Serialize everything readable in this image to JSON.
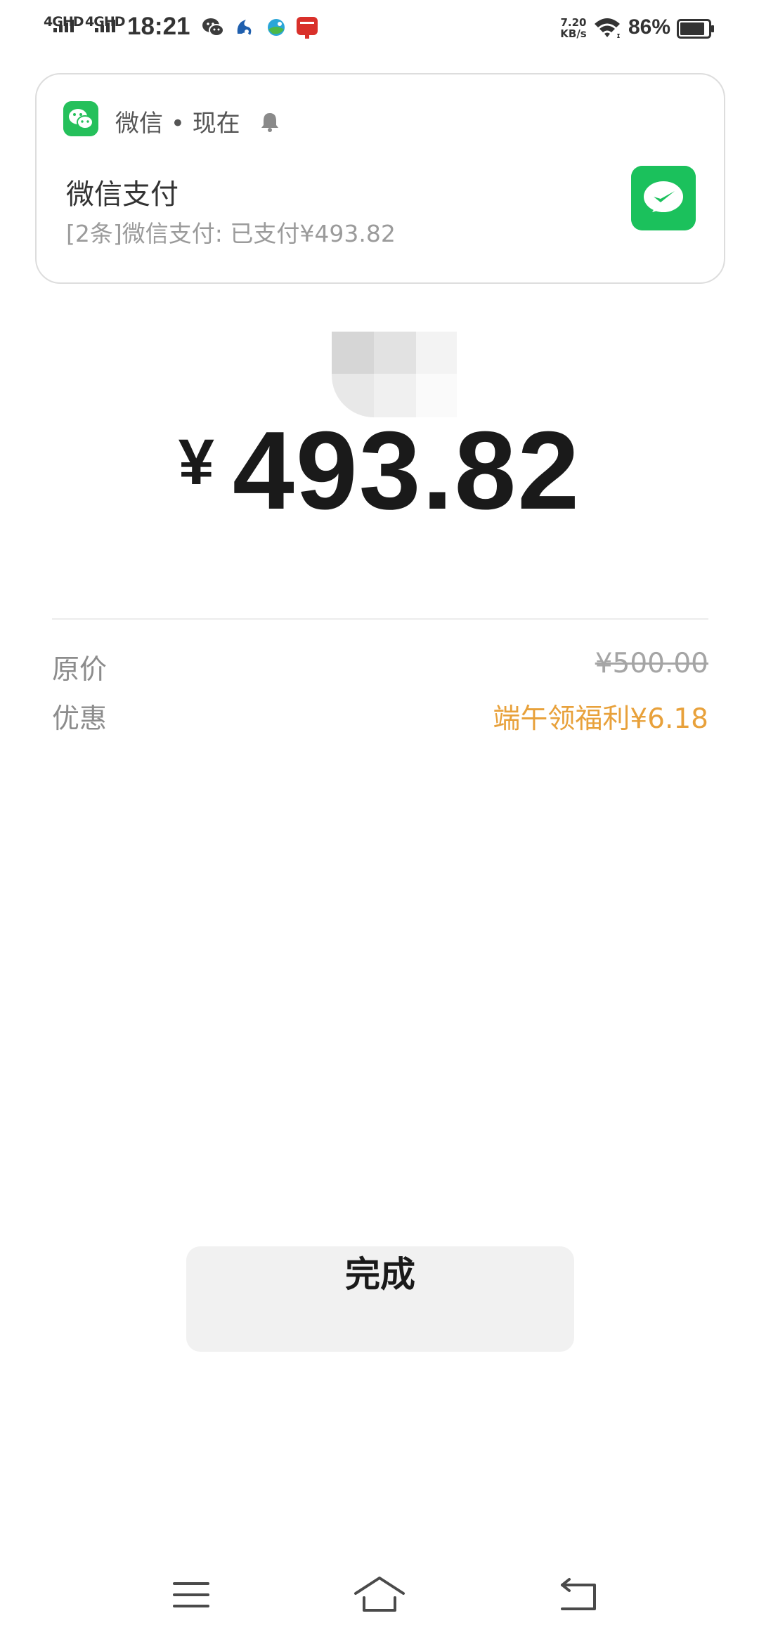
{
  "status_bar": {
    "signal1": "4GHD",
    "signal2": "4GHD",
    "time": "18:21",
    "net_speed_value": "7.20",
    "net_speed_unit": "KB/s",
    "battery_pct": "86%"
  },
  "notification": {
    "app_name": "微信",
    "separator": "•",
    "time": "现在",
    "title": "微信支付",
    "body": "[2条]微信支付: 已支付¥493.82"
  },
  "payment": {
    "currency": "¥",
    "amount": "493.82"
  },
  "details": [
    {
      "label": "原价",
      "value": "¥500.00"
    },
    {
      "label": "优惠",
      "value": "端午领福利¥6.18"
    }
  ],
  "done_label": "完成",
  "colors": {
    "wechat_green": "#1bc15c",
    "discount_orange": "#e8a13b"
  },
  "icons": [
    "wechat-icon",
    "bell-icon",
    "wechat-pay-icon",
    "menu-icon",
    "home-icon",
    "back-icon",
    "wifi-icon",
    "battery-icon"
  ]
}
